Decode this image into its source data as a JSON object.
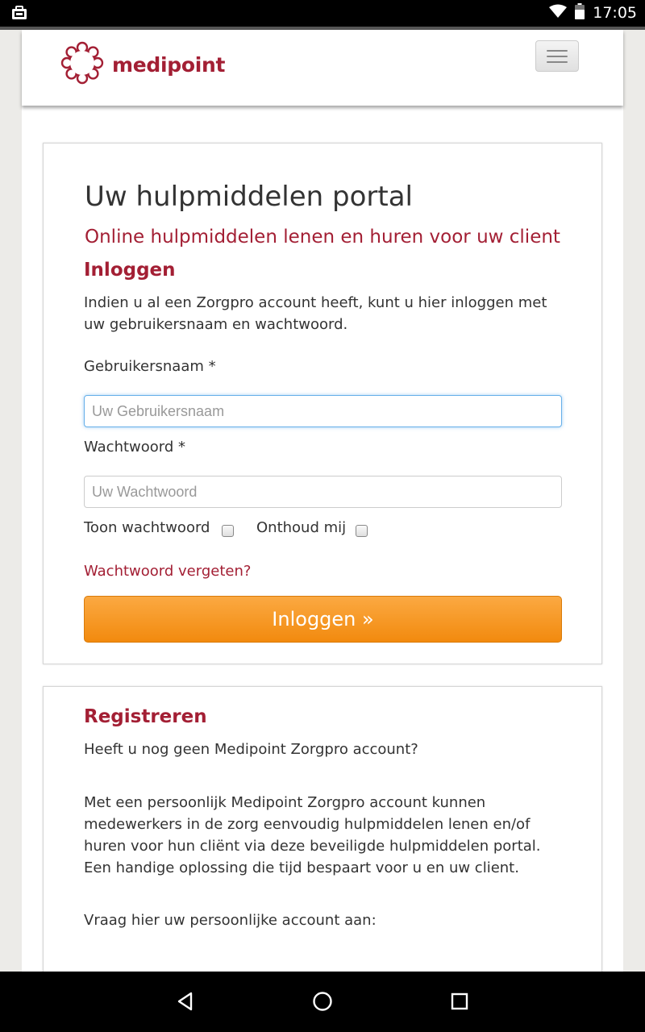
{
  "status_bar": {
    "time": "17:05",
    "icons": [
      "briefcase-icon",
      "wifi-icon",
      "battery-icon"
    ]
  },
  "header": {
    "logo_text": "medipoint",
    "menu_icon": "hamburger-menu-icon"
  },
  "login_card": {
    "title": "Uw hulpmiddelen portal",
    "subtitle": "Online hulpmiddelen lenen en huren voor uw client",
    "heading": "Inloggen",
    "intro": "Indien u al een Zorgpro account heeft, kunt u hier inloggen met uw gebruikersnaam en wachtwoord.",
    "username_label": "Gebruikersnaam *",
    "username_placeholder": "Uw Gebruikersnaam",
    "username_value": "",
    "password_label": "Wachtwoord *",
    "password_placeholder": "Uw Wachtwoord",
    "password_value": "",
    "show_password_label": "Toon wachtwoord",
    "show_password_checked": false,
    "remember_me_label": "Onthoud mij",
    "remember_me_checked": false,
    "forgot_password_link": "Wachtwoord vergeten?",
    "login_button": "Inloggen »"
  },
  "register_card": {
    "heading": "Registreren",
    "question": "Heeft u nog geen Medipoint Zorgpro account?",
    "description": "Met een persoonlijk Medipoint Zorgpro account kunnen medewerkers in de zorg eenvoudig hulpmiddelen lenen en/of huren voor hun cliënt via deze beveiligde hulpmiddelen portal. Een handige oplossing die tijd bespaart voor u en uw client.",
    "request_text": "Vraag hier uw persoonlijke account aan:"
  },
  "nav_bar": {
    "buttons": [
      "back-icon",
      "home-icon",
      "recents-icon"
    ]
  },
  "colors": {
    "brand": "#a31f34",
    "button": "#f5921e",
    "focus": "#66afe9"
  }
}
